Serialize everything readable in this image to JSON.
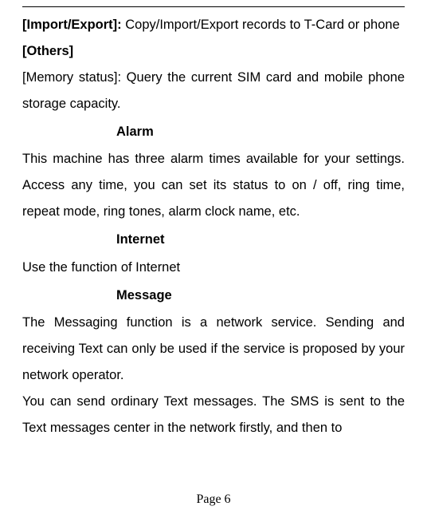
{
  "topDividerPresent": true,
  "importExport": {
    "label": "[Import/Export]:",
    "text": " Copy/Import/Export records to T-Card or phone"
  },
  "others": {
    "label": "[Others]"
  },
  "memoryStatus": {
    "text": "[Memory status]: Query the current SIM card and mobile phone storage capacity."
  },
  "sections": {
    "alarm": {
      "heading": "Alarm",
      "body": "This machine has three alarm times available for your settings. Access any time, you can set its status to on / off, ring time, repeat mode, ring tones, alarm clock name, etc."
    },
    "internet": {
      "heading": "Internet",
      "body": "Use the function of Internet"
    },
    "message": {
      "heading": "Message",
      "body1": "The Messaging function is a network service. Sending and receiving Text can only be used if the service is proposed by your network operator.",
      "body2": "You can send ordinary Text messages. The SMS is sent to the Text messages center in the network firstly, and then to"
    }
  },
  "pageNumber": "Page 6"
}
